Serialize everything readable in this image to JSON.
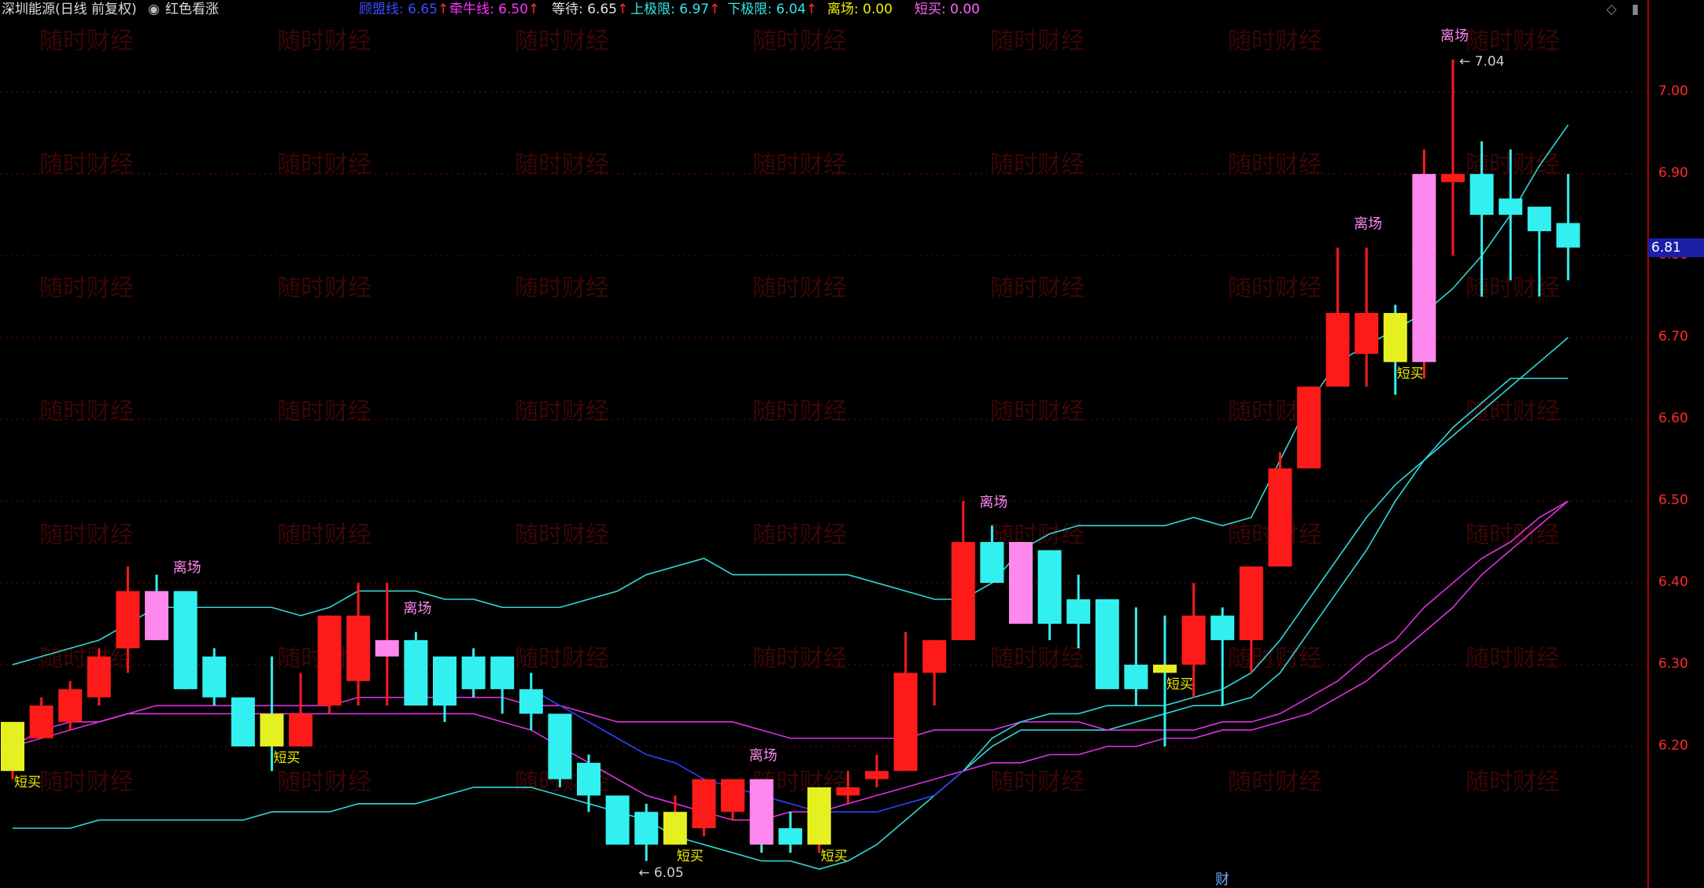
{
  "header": {
    "stock_name": "深圳能源(日线 前复权)",
    "indicator_icon": "circle-dot-icon",
    "indicator_name": "红色看涨",
    "items": [
      {
        "key": "mid",
        "label": "顾盟线:",
        "value": "6.65",
        "color": "#3b4cff",
        "arrow": true
      },
      {
        "key": "bull",
        "label": "牵牛线:",
        "value": "6.50",
        "color": "#ff33ff",
        "arrow": true
      },
      {
        "key": "wait",
        "label": "等待:",
        "value": "6.65",
        "color": "#e0e0e0",
        "arrow": true
      },
      {
        "key": "upper",
        "label": "上极限:",
        "value": "6.97",
        "color": "#33e6e6",
        "arrow": true
      },
      {
        "key": "lower",
        "label": "下极限:",
        "value": "6.04",
        "color": "#33e6e6",
        "arrow": true
      },
      {
        "key": "exit",
        "label": "离场:",
        "value": "0.00",
        "color": "#f0f000",
        "arrow": false
      },
      {
        "key": "buy",
        "label": "短买:",
        "value": "0.00",
        "color": "#ff66ff",
        "arrow": false
      }
    ],
    "diamond_icon": "diamond-icon"
  },
  "price_axis": {
    "ticks": [
      "7.00",
      "6.90",
      "6.80",
      "6.70",
      "6.60",
      "6.50",
      "6.40",
      "6.30",
      "6.20"
    ],
    "current_price": "6.81"
  },
  "annotations": {
    "high": "7.04",
    "low": "6.05",
    "exit_label": "离场",
    "buy_label": "短买",
    "finance_marker": "财"
  },
  "watermark": "随时财经",
  "colors": {
    "up": "#ff1a1a",
    "down": "#33f0f0",
    "exit_fill": "#ff88ee",
    "buy_fill": "#e6f020",
    "grid": "#8b0000"
  },
  "chart_data": {
    "type": "candlestick",
    "ylim": [
      6.05,
      7.08
    ],
    "candles": [
      {
        "o": 6.17,
        "h": 6.23,
        "l": 6.16,
        "c": 6.23
      },
      {
        "o": 6.21,
        "h": 6.26,
        "l": 6.21,
        "c": 6.25
      },
      {
        "o": 6.23,
        "h": 6.28,
        "l": 6.22,
        "c": 6.27
      },
      {
        "o": 6.26,
        "h": 6.32,
        "l": 6.25,
        "c": 6.31
      },
      {
        "o": 6.32,
        "h": 6.42,
        "l": 6.29,
        "c": 6.39
      },
      {
        "o": 6.39,
        "h": 6.41,
        "l": 6.33,
        "c": 6.33
      },
      {
        "o": 6.39,
        "h": 6.39,
        "l": 6.27,
        "c": 6.27
      },
      {
        "o": 6.31,
        "h": 6.32,
        "l": 6.25,
        "c": 6.26
      },
      {
        "o": 6.26,
        "h": 6.26,
        "l": 6.2,
        "c": 6.2
      },
      {
        "o": 6.24,
        "h": 6.31,
        "l": 6.17,
        "c": 6.2
      },
      {
        "o": 6.2,
        "h": 6.29,
        "l": 6.2,
        "c": 6.24
      },
      {
        "o": 6.25,
        "h": 6.36,
        "l": 6.24,
        "c": 6.36
      },
      {
        "o": 6.28,
        "h": 6.4,
        "l": 6.25,
        "c": 6.36
      },
      {
        "o": 6.31,
        "h": 6.4,
        "l": 6.25,
        "c": 6.33
      },
      {
        "o": 6.33,
        "h": 6.34,
        "l": 6.25,
        "c": 6.25
      },
      {
        "o": 6.31,
        "h": 6.31,
        "l": 6.23,
        "c": 6.25
      },
      {
        "o": 6.31,
        "h": 6.32,
        "l": 6.26,
        "c": 6.27
      },
      {
        "o": 6.31,
        "h": 6.31,
        "l": 6.24,
        "c": 6.27
      },
      {
        "o": 6.27,
        "h": 6.29,
        "l": 6.22,
        "c": 6.24
      },
      {
        "o": 6.24,
        "h": 6.24,
        "l": 6.15,
        "c": 6.16
      },
      {
        "o": 6.18,
        "h": 6.19,
        "l": 6.12,
        "c": 6.14
      },
      {
        "o": 6.14,
        "h": 6.14,
        "l": 6.08,
        "c": 6.08
      },
      {
        "o": 6.12,
        "h": 6.13,
        "l": 6.06,
        "c": 6.08
      },
      {
        "o": 6.08,
        "h": 6.14,
        "l": 6.08,
        "c": 6.12
      },
      {
        "o": 6.1,
        "h": 6.16,
        "l": 6.09,
        "c": 6.16
      },
      {
        "o": 6.12,
        "h": 6.16,
        "l": 6.11,
        "c": 6.16
      },
      {
        "o": 6.16,
        "h": 6.16,
        "l": 6.07,
        "c": 6.08
      },
      {
        "o": 6.1,
        "h": 6.12,
        "l": 6.07,
        "c": 6.08
      },
      {
        "o": 6.08,
        "h": 6.15,
        "l": 6.07,
        "c": 6.15
      },
      {
        "o": 6.14,
        "h": 6.17,
        "l": 6.13,
        "c": 6.15
      },
      {
        "o": 6.16,
        "h": 6.19,
        "l": 6.15,
        "c": 6.17
      },
      {
        "o": 6.17,
        "h": 6.34,
        "l": 6.17,
        "c": 6.29
      },
      {
        "o": 6.29,
        "h": 6.33,
        "l": 6.25,
        "c": 6.33
      },
      {
        "o": 6.33,
        "h": 6.5,
        "l": 6.33,
        "c": 6.45
      },
      {
        "o": 6.45,
        "h": 6.47,
        "l": 6.4,
        "c": 6.4
      },
      {
        "o": 6.45,
        "h": 6.45,
        "l": 6.35,
        "c": 6.35
      },
      {
        "o": 6.44,
        "h": 6.44,
        "l": 6.33,
        "c": 6.35
      },
      {
        "o": 6.38,
        "h": 6.41,
        "l": 6.32,
        "c": 6.35
      },
      {
        "o": 6.38,
        "h": 6.38,
        "l": 6.27,
        "c": 6.27
      },
      {
        "o": 6.3,
        "h": 6.37,
        "l": 6.25,
        "c": 6.27
      },
      {
        "o": 6.3,
        "h": 6.36,
        "l": 6.2,
        "c": 6.29
      },
      {
        "o": 6.3,
        "h": 6.4,
        "l": 6.26,
        "c": 6.36
      },
      {
        "o": 6.36,
        "h": 6.37,
        "l": 6.25,
        "c": 6.33
      },
      {
        "o": 6.33,
        "h": 6.42,
        "l": 6.29,
        "c": 6.42
      },
      {
        "o": 6.42,
        "h": 6.56,
        "l": 6.42,
        "c": 6.54
      },
      {
        "o": 6.54,
        "h": 6.64,
        "l": 6.54,
        "c": 6.64
      },
      {
        "o": 6.64,
        "h": 6.81,
        "l": 6.64,
        "c": 6.73
      },
      {
        "o": 6.68,
        "h": 6.81,
        "l": 6.64,
        "c": 6.73
      },
      {
        "o": 6.73,
        "h": 6.74,
        "l": 6.63,
        "c": 6.67
      },
      {
        "o": 6.67,
        "h": 6.93,
        "l": 6.65,
        "c": 6.9
      },
      {
        "o": 6.89,
        "h": 7.04,
        "l": 6.8,
        "c": 6.9
      },
      {
        "o": 6.9,
        "h": 6.94,
        "l": 6.75,
        "c": 6.85
      },
      {
        "o": 6.87,
        "h": 6.93,
        "l": 6.77,
        "c": 6.85
      },
      {
        "o": 6.86,
        "h": 6.86,
        "l": 6.75,
        "c": 6.83
      },
      {
        "o": 6.84,
        "h": 6.9,
        "l": 6.77,
        "c": 6.81
      }
    ],
    "upper_band": [
      6.3,
      6.31,
      6.32,
      6.33,
      6.35,
      6.37,
      6.37,
      6.37,
      6.37,
      6.37,
      6.36,
      6.37,
      6.39,
      6.39,
      6.39,
      6.38,
      6.38,
      6.37,
      6.37,
      6.37,
      6.38,
      6.39,
      6.41,
      6.42,
      6.43,
      6.41,
      6.41,
      6.41,
      6.41,
      6.41,
      6.4,
      6.39,
      6.38,
      6.38,
      6.4,
      6.44,
      6.46,
      6.47,
      6.47,
      6.47,
      6.47,
      6.48,
      6.47,
      6.48,
      6.55,
      6.62,
      6.67,
      6.69,
      6.71,
      6.73,
      6.76,
      6.8,
      6.85,
      6.91,
      6.96
    ],
    "lower_band": [
      6.1,
      6.1,
      6.1,
      6.11,
      6.11,
      6.11,
      6.11,
      6.11,
      6.11,
      6.12,
      6.12,
      6.12,
      6.13,
      6.13,
      6.13,
      6.14,
      6.15,
      6.15,
      6.15,
      6.14,
      6.13,
      6.12,
      6.11,
      6.09,
      6.08,
      6.07,
      6.06,
      6.06,
      6.05,
      6.06,
      6.08,
      6.11,
      6.14,
      6.17,
      6.2,
      6.22,
      6.22,
      6.22,
      6.22,
      6.23,
      6.24,
      6.25,
      6.25,
      6.26,
      6.29,
      6.34,
      6.39,
      6.44,
      6.5,
      6.55,
      6.58,
      6.61,
      6.64,
      6.67,
      6.7
    ],
    "mid_line": [
      null,
      null,
      null,
      null,
      null,
      null,
      null,
      null,
      null,
      null,
      null,
      null,
      null,
      null,
      null,
      null,
      null,
      null,
      6.27,
      6.25,
      6.23,
      6.21,
      6.19,
      6.18,
      6.16,
      6.15,
      6.14,
      6.13,
      6.12,
      6.12,
      6.12,
      6.13,
      6.14,
      6.17,
      6.21,
      6.23,
      6.24,
      6.24,
      6.25,
      6.25,
      6.25,
      6.26,
      6.27,
      6.29,
      6.33,
      6.38,
      6.43,
      6.48,
      6.52,
      6.55,
      6.59,
      6.62,
      6.65,
      6.65,
      6.65
    ],
    "bull_line": [
      6.2,
      6.22,
      6.23,
      6.23,
      6.24,
      6.25,
      6.25,
      6.25,
      6.25,
      6.25,
      6.25,
      6.25,
      6.26,
      6.26,
      6.26,
      6.26,
      6.26,
      6.26,
      6.25,
      6.25,
      6.24,
      6.23,
      6.23,
      6.23,
      6.23,
      6.23,
      6.22,
      6.21,
      6.21,
      6.21,
      6.21,
      6.21,
      6.22,
      6.22,
      6.22,
      6.23,
      6.23,
      6.23,
      6.22,
      6.22,
      6.22,
      6.22,
      6.23,
      6.23,
      6.24,
      6.26,
      6.28,
      6.31,
      6.33,
      6.37,
      6.4,
      6.43,
      6.45,
      6.48,
      6.5
    ],
    "bear_line": [
      6.2,
      6.21,
      6.22,
      6.23,
      6.24,
      6.24,
      6.24,
      6.24,
      6.24,
      6.24,
      6.24,
      6.24,
      6.24,
      6.24,
      6.24,
      6.24,
      6.24,
      6.23,
      6.22,
      6.2,
      6.18,
      6.16,
      6.14,
      6.13,
      6.12,
      6.11,
      6.11,
      6.12,
      6.12,
      6.13,
      6.14,
      6.15,
      6.16,
      6.17,
      6.18,
      6.18,
      6.19,
      6.19,
      6.2,
      6.2,
      6.21,
      6.21,
      6.22,
      6.22,
      6.23,
      6.24,
      6.26,
      6.28,
      6.31,
      6.34,
      6.37,
      6.41,
      6.44,
      6.47,
      6.5
    ],
    "exit_signals": [
      5,
      13,
      26,
      35,
      48,
      49
    ],
    "buy_signals": [
      0,
      9,
      23,
      28,
      40,
      48
    ],
    "exit_label_bars": [
      6,
      14,
      26,
      34,
      47,
      50
    ]
  }
}
